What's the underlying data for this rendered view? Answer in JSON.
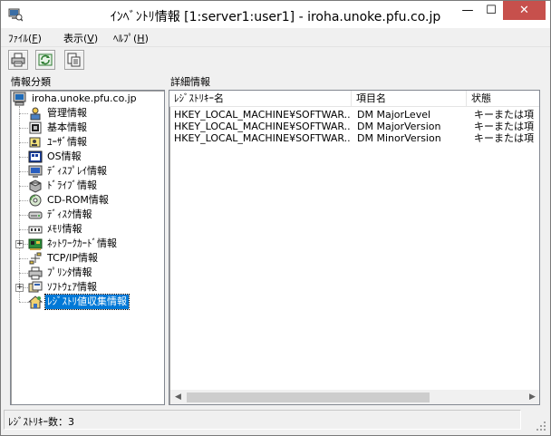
{
  "window": {
    "title": "ｲﾝﾍﾞﾝﾄﾘ情報 [1:server1:user1] - iroha.unoke.pfu.co.jp",
    "minimize_glyph": "—",
    "maximize_glyph": "☐",
    "close_glyph": "✕"
  },
  "menu": {
    "items": [
      {
        "label": "ﾌｧｲﾙ(",
        "key": "F",
        "close": ")"
      },
      {
        "label": "表示(",
        "key": "V",
        "close": ")"
      },
      {
        "label": "ﾍﾙﾌﾟ(",
        "key": "H",
        "close": ")"
      }
    ]
  },
  "toolbar": {
    "buttons": [
      {
        "icon": "print-icon"
      },
      {
        "icon": "refresh-icon"
      },
      {
        "icon": "export-icon"
      }
    ]
  },
  "tree": {
    "heading": "情報分類",
    "root": "iroha.unoke.pfu.co.jp",
    "items": [
      {
        "label": "管理情報",
        "icon": "management-icon",
        "expandable": false
      },
      {
        "label": "基本情報",
        "icon": "basic-info-icon",
        "expandable": false
      },
      {
        "label": "ﾕｰｻﾞ情報",
        "icon": "user-icon",
        "expandable": false
      },
      {
        "label": "OS情報",
        "icon": "os-icon",
        "expandable": false
      },
      {
        "label": "ﾃﾞｨｽﾌﾟﾚｲ情報",
        "icon": "display-icon",
        "expandable": false
      },
      {
        "label": "ﾄﾞﾗｲﾌﾞ情報",
        "icon": "drive-icon",
        "expandable": false
      },
      {
        "label": "CD-ROM情報",
        "icon": "cdrom-icon",
        "expandable": false
      },
      {
        "label": "ﾃﾞｨｽｸ情報",
        "icon": "disk-icon",
        "expandable": false
      },
      {
        "label": "ﾒﾓﾘ情報",
        "icon": "memory-icon",
        "expandable": false
      },
      {
        "label": "ﾈｯﾄﾜｰｸｶｰﾄﾞ情報",
        "icon": "network-card-icon",
        "expandable": true
      },
      {
        "label": "TCP/IP情報",
        "icon": "tcpip-icon",
        "expandable": false
      },
      {
        "label": "ﾌﾟﾘﾝﾀ情報",
        "icon": "printer-icon",
        "expandable": false
      },
      {
        "label": "ｿﾌﾄｳｪｱ情報",
        "icon": "software-icon",
        "expandable": true
      },
      {
        "label": "ﾚｼﾞｽﾄﾘ値収集情報",
        "icon": "registry-icon",
        "expandable": false,
        "selected": true
      }
    ]
  },
  "detail": {
    "heading": "詳細情報",
    "columns": [
      "ﾚｼﾞｽﾄﾘｷｰ名",
      "項目名",
      "状態"
    ],
    "rows": [
      [
        "HKEY_LOCAL_MACHINE¥SOFTWAR...",
        "DM MajorLevel",
        "キーまたは項"
      ],
      [
        "HKEY_LOCAL_MACHINE¥SOFTWAR...",
        "DM MajorVersion",
        "キーまたは項"
      ],
      [
        "HKEY_LOCAL_MACHINE¥SOFTWAR...",
        "DM MinorVersion",
        "キーまたは項"
      ]
    ]
  },
  "scrollbar": {
    "left_arrow": "◀",
    "right_arrow": "▶"
  },
  "status": {
    "text": "ﾚｼﾞｽﾄﾘｷｰ数：3"
  }
}
